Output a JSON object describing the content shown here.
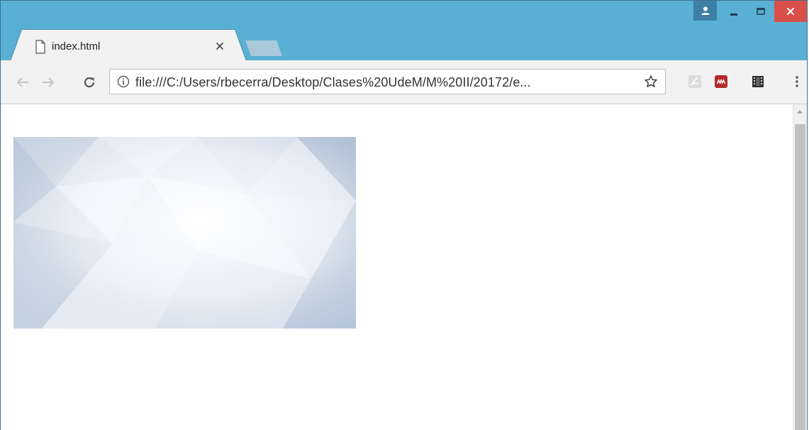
{
  "window": {
    "controls": {
      "user_icon": "user-icon",
      "minimize_icon": "minimize-icon",
      "maximize_icon": "maximize-icon",
      "close_icon": "close-icon"
    }
  },
  "tabs": [
    {
      "title": "index.html",
      "icon": "document-icon",
      "active": true
    }
  ],
  "toolbar": {
    "back_icon": "back-arrow-icon",
    "forward_icon": "forward-arrow-icon",
    "reload_icon": "reload-icon",
    "address": "file:///C:/Users/rbecerra/Desktop/Clases%20UdeM/M%20II/20172/e...",
    "info_icon": "info-icon",
    "bookmark_icon": "star-icon",
    "extensions": [
      {
        "name": "pdf-extension-icon"
      },
      {
        "name": "mega-extension-icon"
      },
      {
        "name": "film-extension-icon"
      }
    ],
    "menu_icon": "kebab-menu-icon"
  },
  "content": {
    "image": "abstract-polygon-background"
  },
  "colors": {
    "titlebar": "#5ab0d4",
    "close_button": "#d9504a",
    "toolbar": "#f2f2f2"
  }
}
